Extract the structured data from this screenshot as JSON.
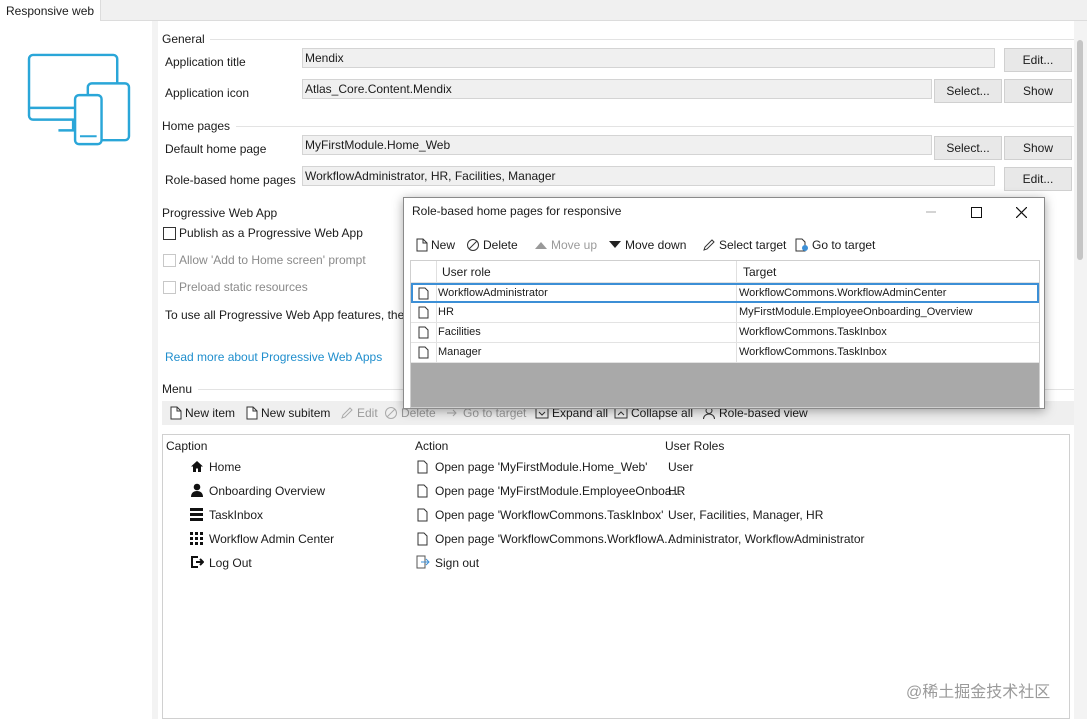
{
  "tab": {
    "label": "Responsive web"
  },
  "general": {
    "title": "General",
    "app_title_label": "Application title",
    "app_title_value": "Mendix",
    "app_icon_label": "Application icon",
    "app_icon_value": "Atlas_Core.Content.Mendix",
    "edit_label": "Edit...",
    "select_label": "Select...",
    "show_label": "Show"
  },
  "home_pages": {
    "title": "Home pages",
    "default_label": "Default home page",
    "default_value": "MyFirstModule.Home_Web",
    "role_based_label": "Role-based home pages",
    "role_based_value": "WorkflowAdministrator, HR, Facilities, Manager",
    "select_label": "Select...",
    "show_label": "Show",
    "edit_label": "Edit..."
  },
  "pwa": {
    "title": "Progressive Web App",
    "publish_label": "Publish as a Progressive Web App",
    "allow_label": "Allow 'Add to Home screen' prompt",
    "preload_label": "Preload static resources",
    "info_text": "To use all Progressive Web App features, the",
    "read_more_link": "Read more about Progressive Web Apps"
  },
  "menu": {
    "title": "Menu",
    "toolbar": {
      "new_item": "New item",
      "new_subitem": "New subitem",
      "edit": "Edit",
      "delete": "Delete",
      "go_to_target": "Go to target",
      "expand_all": "Expand all",
      "collapse_all": "Collapse all",
      "role_based_view": "Role-based view"
    },
    "columns": {
      "caption": "Caption",
      "action": "Action",
      "user_roles": "User Roles"
    },
    "items": [
      {
        "caption": "Home",
        "icon": "home-icon",
        "action": "Open page 'MyFirstModule.Home_Web'",
        "roles": "User"
      },
      {
        "caption": "Onboarding Overview",
        "icon": "user-icon",
        "action": "Open  page 'MyFirstModule.EmployeeOnboa...",
        "roles": "HR"
      },
      {
        "caption": "TaskInbox",
        "icon": "list-icon",
        "action": "Open page 'WorkflowCommons.TaskInbox'",
        "roles": "User, Facilities, Manager, HR"
      },
      {
        "caption": "Workflow Admin Center",
        "icon": "grid-icon",
        "action": "Open  page 'WorkflowCommons.WorkflowA...",
        "roles": "Administrator, WorkflowAdministrator"
      },
      {
        "caption": "Log Out",
        "icon": "logout-icon",
        "action": "Sign out",
        "roles": ""
      }
    ]
  },
  "dialog": {
    "title": "Role-based home pages for responsive",
    "toolbar": {
      "new": "New",
      "delete": "Delete",
      "move_up": "Move up",
      "move_down": "Move down",
      "select_target": "Select target",
      "go_to_target": "Go to target"
    },
    "columns": {
      "user_role": "User role",
      "target": "Target"
    },
    "rows": [
      {
        "role": "WorkflowAdministrator",
        "target": "WorkflowCommons.WorkflowAdminCenter",
        "selected": true
      },
      {
        "role": "HR",
        "target": "MyFirstModule.EmployeeOnboarding_Overview",
        "selected": false
      },
      {
        "role": "Facilities",
        "target": "WorkflowCommons.TaskInbox",
        "selected": false
      },
      {
        "role": "Manager",
        "target": "WorkflowCommons.TaskInbox",
        "selected": false
      }
    ]
  },
  "watermark": "@稀土掘金技术社区",
  "colors": {
    "link": "#1f8ecd",
    "selection": "#3c8fd6",
    "device_icon": "#2aa6d8"
  }
}
